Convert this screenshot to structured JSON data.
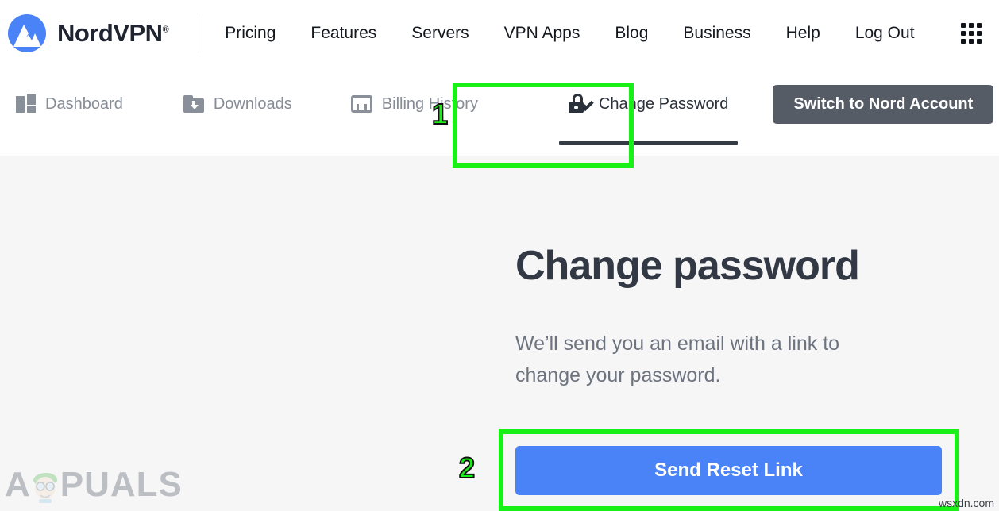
{
  "brand": {
    "name": "NordVPN",
    "registered_mark": "®",
    "logo_icon": "nordvpn-mountain-logo"
  },
  "header": {
    "nav_links": [
      {
        "label": "Pricing"
      },
      {
        "label": "Features"
      },
      {
        "label": "Servers"
      },
      {
        "label": "VPN Apps"
      },
      {
        "label": "Blog"
      },
      {
        "label": "Business"
      },
      {
        "label": "Help"
      },
      {
        "label": "Log Out"
      }
    ],
    "apps_grid_icon": "apps-grid-icon"
  },
  "subnav": {
    "tabs": [
      {
        "label": "Dashboard",
        "icon": "dashboard-grid-icon",
        "active": false
      },
      {
        "label": "Downloads",
        "icon": "folder-download-icon",
        "active": false
      },
      {
        "label": "Billing History",
        "icon": "inbox-tray-icon",
        "active": false
      },
      {
        "label": "Change Password",
        "icon": "lock-edit-icon",
        "active": true
      }
    ],
    "switch_button": "Switch to Nord Account",
    "account_email_blurred": ""
  },
  "main": {
    "title": "Change password",
    "description": "We’ll send you an email with a link to change your password.",
    "submit_button": "Send Reset Link"
  },
  "annotations": {
    "step_one": "1",
    "step_two": "2",
    "highlight_color": "#18f018"
  },
  "watermarks": {
    "appuals": "PUALS",
    "appuals_full": "APPUALS",
    "source": "wsxdn.com"
  },
  "colors": {
    "brand_blue": "#4a82f7",
    "button_blue": "#4a82f7",
    "switch_gray": "#565c66",
    "page_bg": "#f6f6f7",
    "heading": "#323945",
    "body_text": "#6d7480"
  }
}
